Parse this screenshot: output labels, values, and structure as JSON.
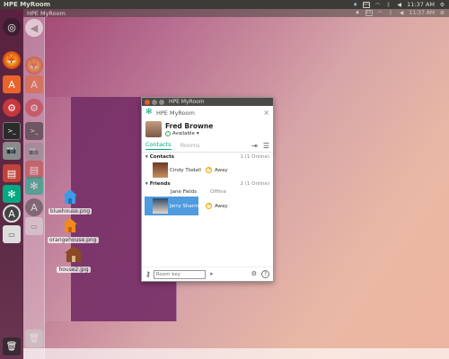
{
  "topbar": {
    "title": "HPE MyRoom",
    "time": "11:37 AM",
    "tray": [
      "en-icon",
      "hp-icon",
      "wifi-icon",
      "keyboard-icon",
      "bluetooth-icon",
      "volume-icon"
    ]
  },
  "topbar2": {
    "title": "HPE MyRoom",
    "time": "11:37 AM"
  },
  "desktop": {
    "icons": [
      {
        "label": "bluehouse.png"
      },
      {
        "label": "orangehouse.png"
      },
      {
        "label": "house2.jpg"
      }
    ]
  },
  "window": {
    "title": "HPE MyRoom",
    "header_title": "HPE MyRoom",
    "close_glyph": "×",
    "profile": {
      "name": "Fred Browne",
      "status": "Available",
      "dropdown_glyph": "▾"
    },
    "tabs": [
      {
        "label": "Contacts"
      },
      {
        "label": "Rooms"
      }
    ],
    "groups": [
      {
        "name": "Contacts",
        "count": "1 (1 Online)",
        "contacts": [
          {
            "name": "Cindy Tisdall",
            "status": "Away"
          }
        ]
      },
      {
        "name": "Friends",
        "count": "2 (1 Online)",
        "contacts": [
          {
            "name": "Jane Fields",
            "status": "Offline"
          },
          {
            "name": "Jerry Sharma",
            "status": "Away"
          }
        ]
      }
    ],
    "room_key_placeholder": "Room key",
    "colors": {
      "accent": "#01a982",
      "away": "#f0a800",
      "available": "#3aa655"
    }
  }
}
